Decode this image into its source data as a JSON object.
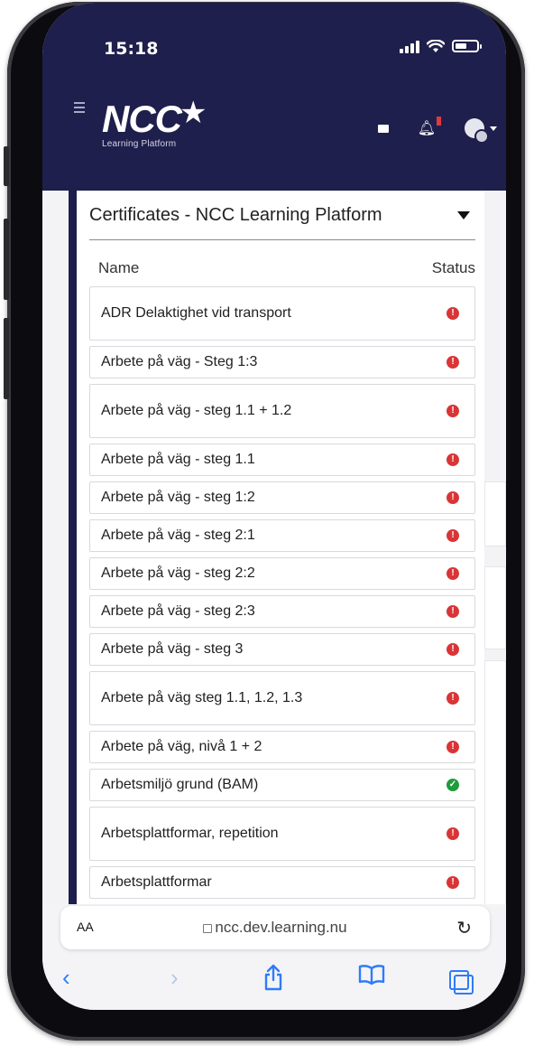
{
  "status_bar": {
    "time": "15:18"
  },
  "header": {
    "brand": "NCC",
    "brand_sub": "Learning Platform",
    "icons": [
      "menu-icon",
      "mail-icon",
      "bell-icon",
      "avatar-icon"
    ]
  },
  "panel": {
    "title": "Certificates - NCC Learning Platform",
    "col_name": "Name",
    "col_status": "Status",
    "rows": [
      {
        "name": "ADR Delaktighet vid transport",
        "status": "warning"
      },
      {
        "name": "Arbete på väg - Steg 1:3",
        "status": "warning"
      },
      {
        "name": "Arbete på väg - steg 1.1 + 1.2",
        "status": "warning"
      },
      {
        "name": "Arbete på väg - steg 1.1",
        "status": "warning"
      },
      {
        "name": "Arbete på väg - steg 1:2",
        "status": "warning"
      },
      {
        "name": "Arbete på väg - steg 2:1",
        "status": "warning"
      },
      {
        "name": "Arbete på väg - steg 2:2",
        "status": "warning"
      },
      {
        "name": "Arbete på väg - steg 2:3",
        "status": "warning"
      },
      {
        "name": "Arbete på väg - steg 3",
        "status": "warning"
      },
      {
        "name": "Arbete på väg steg 1.1, 1.2, 1.3",
        "status": "warning"
      },
      {
        "name": "Arbete på väg, nivå 1 + 2",
        "status": "warning"
      },
      {
        "name": "Arbetsmiljö grund (BAM)",
        "status": "ok"
      },
      {
        "name": "Arbetsplattformar, repetition",
        "status": "warning"
      },
      {
        "name": "Arbetsplattformar",
        "status": "warning"
      }
    ]
  },
  "browser": {
    "text_size": "AA",
    "url": "ncc.dev.learning.nu"
  },
  "colors": {
    "header_bg": "#1f1f4d",
    "warning": "#d93536",
    "ok": "#1e9c3c",
    "ios_blue": "#2f7cf6"
  }
}
